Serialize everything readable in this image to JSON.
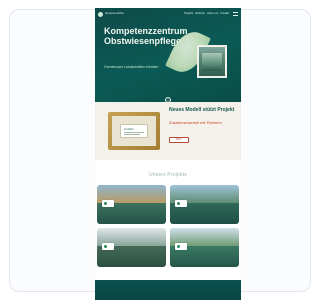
{
  "site": {
    "logo_text": "Gruenes Erbe",
    "nav": [
      "Projekte",
      "Methode",
      "Ueber uns",
      "Kontakt"
    ],
    "hero": {
      "title": "Kompetenzzentrum Obstwiesenpflege",
      "subtitle": "Gemeinsam Landschaften erhalten"
    },
    "feature": {
      "doc_title": "Zertifikat",
      "title": "Neues Modell stützt Projekt",
      "subtitle": "Zusammenarbeit mit Partnern",
      "button_label": "Mehr"
    },
    "gallery": {
      "heading": "Unsere Projekte"
    }
  },
  "colors": {
    "primary": "#0b5a55",
    "accent": "#d1442f",
    "card_border": "#e3e6ef"
  }
}
